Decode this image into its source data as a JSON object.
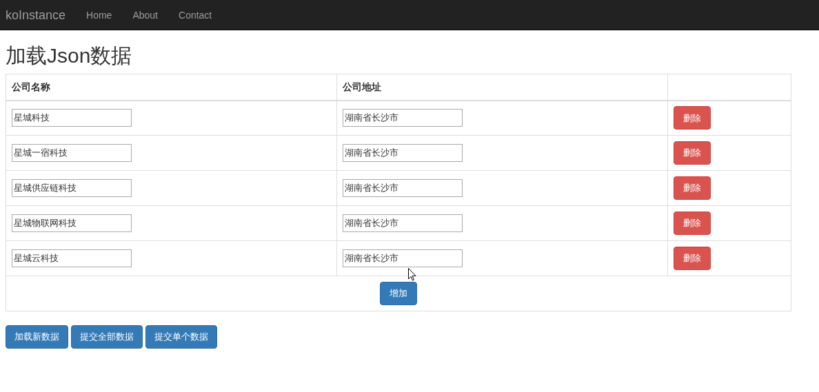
{
  "navbar": {
    "brand": "koInstance",
    "links": [
      "Home",
      "About",
      "Contact"
    ]
  },
  "heading": "加载Json数据",
  "table": {
    "columns": [
      "公司名称",
      "公司地址"
    ],
    "rows": [
      {
        "name": "星城科技",
        "address": "湖南省长沙市",
        "action": "删除"
      },
      {
        "name": "星城一宿科技",
        "address": "湖南省长沙市",
        "action": "删除"
      },
      {
        "name": "星城供应链科技",
        "address": "湖南省长沙市",
        "action": "删除"
      },
      {
        "name": "星城物联网科技",
        "address": "湖南省长沙市",
        "action": "删除"
      },
      {
        "name": "星城云科技",
        "address": "湖南省长沙市",
        "action": "删除"
      }
    ],
    "add_button": "增加"
  },
  "buttons": [
    "加载新数据",
    "提交全部数据",
    "提交单个数据"
  ]
}
